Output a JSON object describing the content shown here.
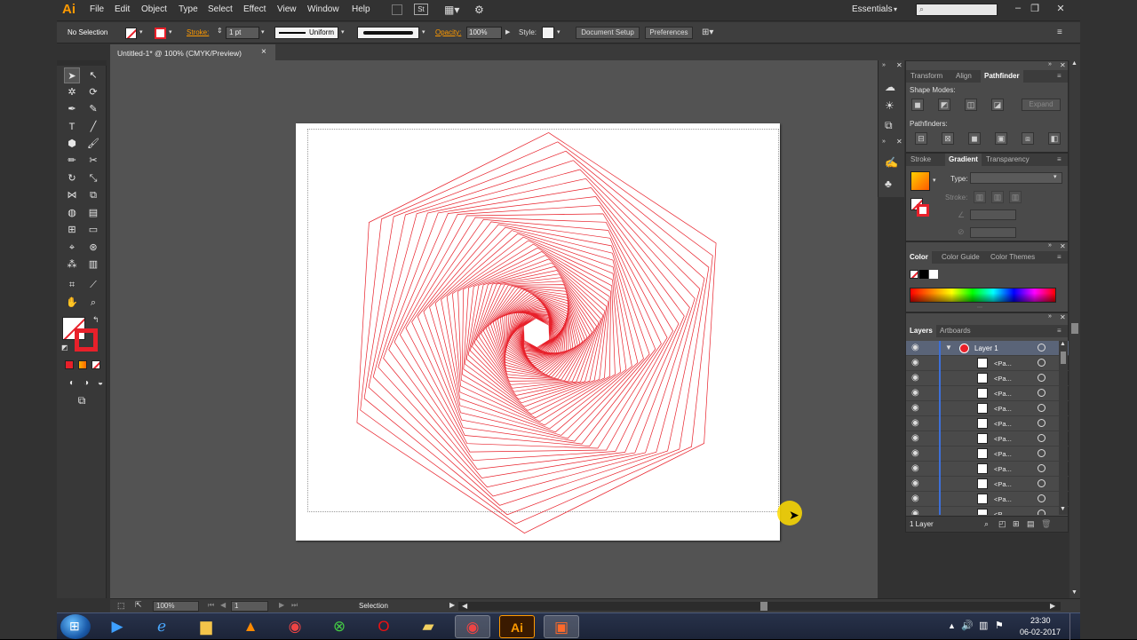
{
  "app": {
    "logo": "Ai"
  },
  "menu": [
    "File",
    "Edit",
    "Object",
    "Type",
    "Select",
    "Effect",
    "View",
    "Window",
    "Help"
  ],
  "menu_extra": {
    "workspace": "Essentials",
    "stock_badge": "St"
  },
  "control": {
    "selection": "No Selection",
    "stroke_label": "Stroke:",
    "stroke_weight": "1 pt",
    "stroke_profile": "Uniform",
    "opacity_label": "Opacity:",
    "opacity_value": "100%",
    "style_label": "Style:",
    "document_setup": "Document Setup",
    "preferences": "Preferences"
  },
  "document_tab": {
    "title": "Untitled-1* @ 100% (CMYK/Preview)",
    "close": "×"
  },
  "status": {
    "zoom": "100%",
    "page": "1",
    "tool": "Selection"
  },
  "pathfinder_panel": {
    "tabs": [
      "Transform",
      "Align",
      "Pathfinder"
    ],
    "shape_modes": "Shape Modes:",
    "pathfinders": "Pathfinders:",
    "expand": "Expand"
  },
  "gradient_panel": {
    "tabs": [
      "Stroke",
      "Gradient",
      "Transparency"
    ],
    "type_label": "Type:",
    "stroke_label": "Stroke:"
  },
  "color_panel": {
    "tabs": [
      "Color",
      "Color Guide",
      "Color Themes"
    ]
  },
  "layers_panel": {
    "tabs": [
      "Layers",
      "Artboards"
    ],
    "layer_name": "Layer 1",
    "sublayers": [
      "<Pa...",
      "<Pa...",
      "<Pa...",
      "<Pa...",
      "<Pa...",
      "<Pa...",
      "<Pa...",
      "<Pa...",
      "<Pa...",
      "<Pa...",
      "<P..."
    ],
    "footer": "1 Layer"
  },
  "clock": {
    "time": "23:30",
    "date": "06-02-2017"
  },
  "colors": {
    "accent": "#e8202a",
    "ai_orange": "#ff9a00",
    "layer_blue": "#3d6fd8"
  }
}
